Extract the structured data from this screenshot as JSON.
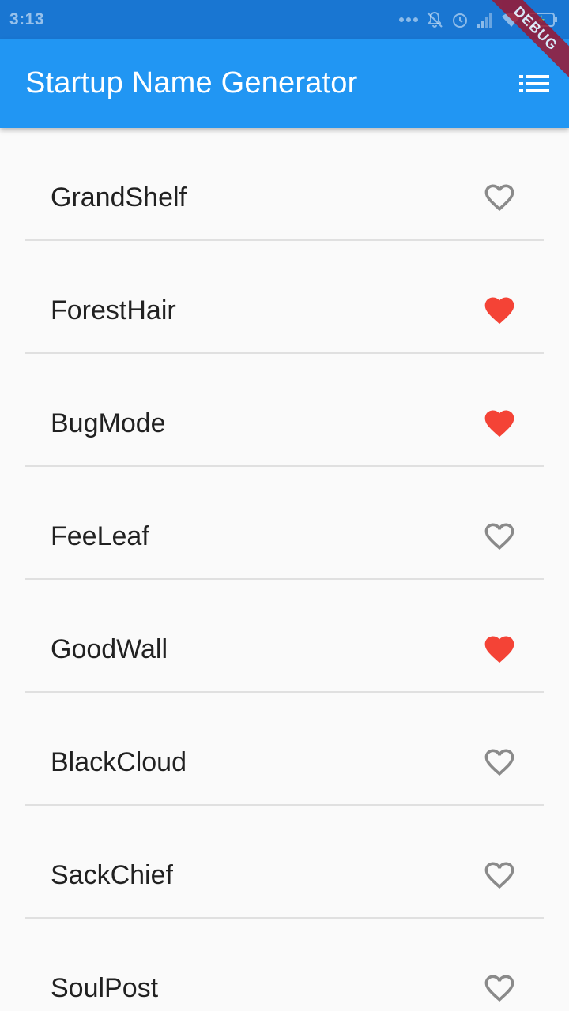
{
  "status_bar": {
    "time": "3:13",
    "icons": [
      "more-dots-icon",
      "notifications-off-icon",
      "alarm-icon",
      "signal-icon",
      "wifi-icon",
      "battery-icon"
    ]
  },
  "app_bar": {
    "title": "Startup Name Generator",
    "action_icon": "list-icon",
    "color": "#2196f3"
  },
  "debug_banner": {
    "label": "DEBUG"
  },
  "list": {
    "items": [
      {
        "label": "GrandShelf",
        "saved": false
      },
      {
        "label": "ForestHair",
        "saved": true
      },
      {
        "label": "BugMode",
        "saved": true
      },
      {
        "label": "FeeLeaf",
        "saved": false
      },
      {
        "label": "GoodWall",
        "saved": true
      },
      {
        "label": "BlackCloud",
        "saved": false
      },
      {
        "label": "SackChief",
        "saved": false
      },
      {
        "label": "SoulPost",
        "saved": false
      }
    ],
    "saved_color": "#f44336",
    "unsaved_color": "#8a8a8a"
  }
}
